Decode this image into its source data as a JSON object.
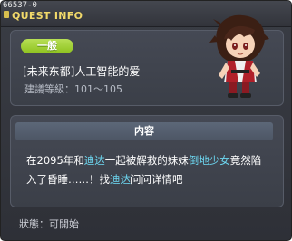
{
  "window": {
    "id": "66537-0",
    "title": "QUEST INFO"
  },
  "quest": {
    "level_tag": "一般",
    "name": "[未来东都]人工智能的爱",
    "level_range": "建議等級：101～105",
    "npc_icon": "npc-character-portrait"
  },
  "content": {
    "header": "内容",
    "line1_a": "在2095年和",
    "line1_b": "迪达",
    "line1_c": "一起被解救的妹妹",
    "line1_d": "倒地少女",
    "line1_e": "竟然陷",
    "line2_a": "入了昏睡……！找",
    "line2_b": "迪达",
    "line2_c": "问问详情吧"
  },
  "status": {
    "label": "狀態：可開始"
  },
  "colors": {
    "title": "#f1d96a",
    "level_tag": "#8ec21f",
    "highlight": "#6dd8f2",
    "panel": "#3b3f48"
  }
}
